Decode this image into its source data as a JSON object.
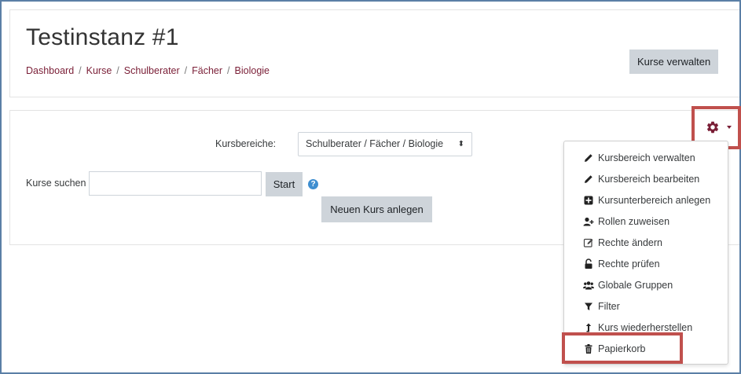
{
  "site": {
    "title": "Testinstanz #1"
  },
  "breadcrumb": [
    "Dashboard",
    "Kurse",
    "Schulberater",
    "Fächer",
    "Biologie"
  ],
  "header": {
    "manage_courses_label": "Kurse verwalten"
  },
  "filter": {
    "category_label": "Kursbereiche:",
    "category_value": "Schulberater / Fächer / Biologie",
    "caret": "⬍"
  },
  "search": {
    "label": "Kurse suchen",
    "value": "",
    "placeholder": "",
    "start_label": "Start",
    "help_icon": "question-circle-icon",
    "help_glyph": "?"
  },
  "actions": {
    "new_course_label": "Neuen Kurs anlegen"
  },
  "settings_menu": {
    "icon": "gear-icon",
    "accent": "#7a1e36",
    "highlight_color": "#c0504d",
    "items": [
      {
        "label": "Kursbereich verwalten",
        "icon": "pencil-icon"
      },
      {
        "label": "Kursbereich bearbeiten",
        "icon": "pencil-icon"
      },
      {
        "label": "Kursunterbereich anlegen",
        "icon": "plus-square-icon"
      },
      {
        "label": "Rollen zuweisen",
        "icon": "user-plus-icon"
      },
      {
        "label": "Rechte ändern",
        "icon": "edit-icon"
      },
      {
        "label": "Rechte prüfen",
        "icon": "unlock-icon"
      },
      {
        "label": "Globale Gruppen",
        "icon": "users-icon"
      },
      {
        "label": "Filter",
        "icon": "filter-icon"
      },
      {
        "label": "Kurs wiederherstellen",
        "icon": "level-up-icon"
      },
      {
        "label": "Papierkorb",
        "icon": "trash-icon"
      }
    ]
  }
}
